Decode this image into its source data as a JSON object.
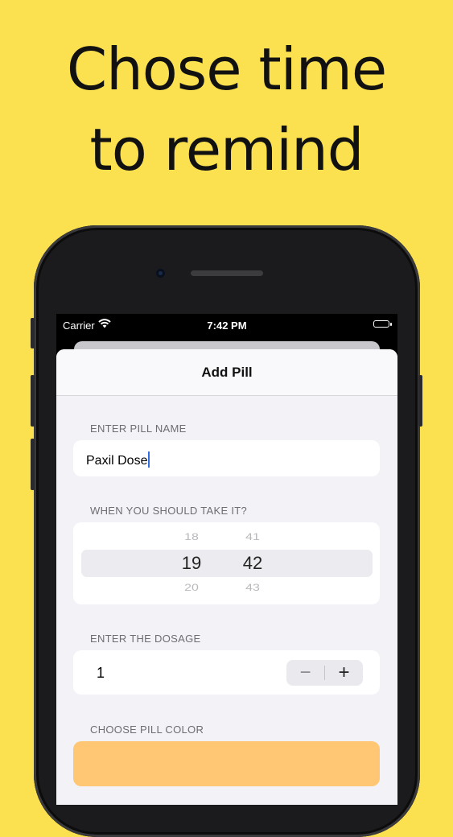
{
  "headline": {
    "line1": "Chose time",
    "line2": "to remind"
  },
  "status_bar": {
    "carrier": "Carrier",
    "time": "7:42 PM"
  },
  "nav": {
    "title": "Add Pill"
  },
  "form": {
    "pill_name_label": "ENTER PILL NAME",
    "pill_name_value": "Paxil Dose",
    "time_label": "WHEN YOU SHOULD TAKE IT?",
    "time_picker": {
      "hours": [
        "18",
        "19",
        "20"
      ],
      "minutes": [
        "41",
        "42",
        "43"
      ]
    },
    "dosage_label": "ENTER THE DOSAGE",
    "dosage_value": "1",
    "stepper": {
      "minus": "−",
      "plus": "+"
    },
    "color_label": "CHOOSE PILL COLOR",
    "selected_color": "#ffc774"
  },
  "colors": {
    "background": "#fbe04f",
    "accent_caret": "#2f6fe0"
  }
}
